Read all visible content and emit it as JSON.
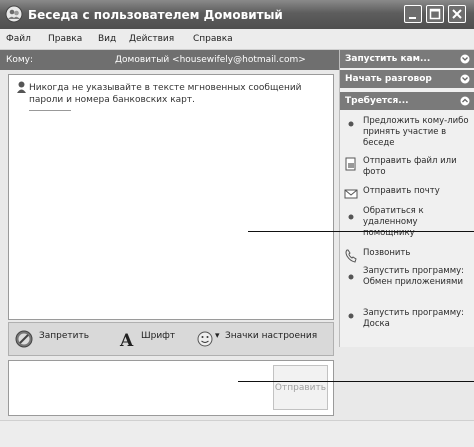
{
  "window": {
    "title": "Беседа с пользователем Домовитый"
  },
  "menu": {
    "items": [
      "Файл",
      "Правка",
      "Вид",
      "Действия",
      "Справка"
    ]
  },
  "to_bar": {
    "label": "Кому:",
    "value": "Домовитый <housewifely@hotmail.com>"
  },
  "message": {
    "warning": "Никогда не указывайте в тексте мгновенных сообщений пароли и номера банковских карт."
  },
  "toolbar": {
    "block_label": "Запретить",
    "font_label": "Шрифт",
    "emoticons_label": "Значки настроения"
  },
  "input": {
    "send_label": "Отправить"
  },
  "right_pane": {
    "panels": [
      {
        "label": "Запустить кам..."
      },
      {
        "label": "Начать разговор"
      },
      {
        "label": "Требуется..."
      }
    ],
    "tasks": [
      {
        "label": "Предложить кому-либо принять участие в беседе",
        "icon": "dot-icon"
      },
      {
        "label": "Отправить файл или фото",
        "icon": "file-icon"
      },
      {
        "label": "Отправить почту",
        "icon": "mail-icon"
      },
      {
        "label": "Обратиться к удаленному помощнику",
        "icon": "dot-icon"
      },
      {
        "label": "Позвонить",
        "icon": "phone-icon"
      },
      {
        "label": "Запустить программу: Обмен приложениями",
        "icon": "dot-icon"
      },
      {
        "label": "Запустить программу: Доска",
        "icon": "dot-icon"
      }
    ]
  },
  "colors": {
    "title_bar": "#5d5d5d",
    "header_bar": "#6f6f6f",
    "panel_header": "#7a7a7a"
  }
}
